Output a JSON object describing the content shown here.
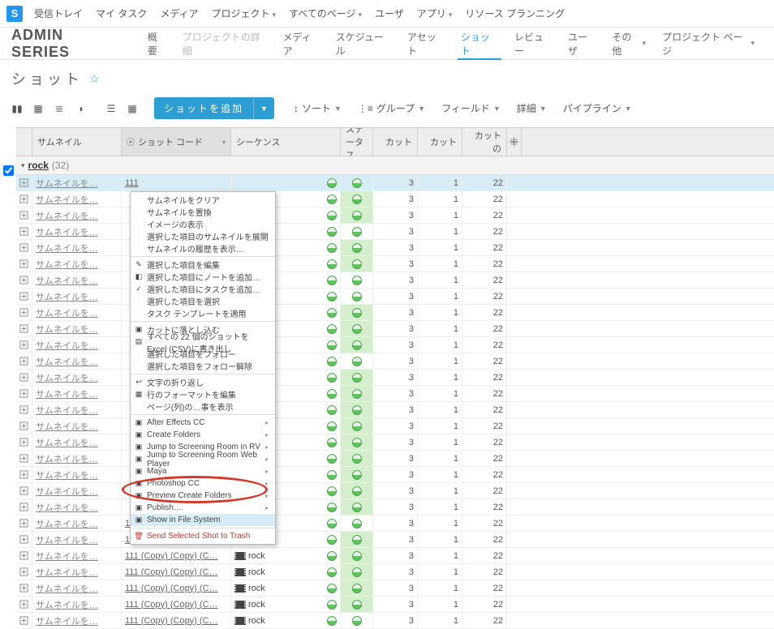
{
  "global_nav": {
    "logo": "S",
    "items": [
      {
        "label": "受信トレイ",
        "dd": false
      },
      {
        "label": "マイ タスク",
        "dd": false
      },
      {
        "label": "メディア",
        "dd": false
      },
      {
        "label": "プロジェクト",
        "dd": true
      },
      {
        "label": "すべてのページ",
        "dd": true
      },
      {
        "label": "ユーザ",
        "dd": false
      },
      {
        "label": "アプリ",
        "dd": true
      },
      {
        "label": "リソース プランニング",
        "dd": false
      }
    ]
  },
  "project_nav": {
    "title": "ADMIN SERIES",
    "items": [
      {
        "label": "概要",
        "dd": false,
        "muted": false
      },
      {
        "label": "プロジェクトの詳細",
        "dd": false,
        "muted": true
      },
      {
        "label": "メディア",
        "dd": false,
        "muted": false
      },
      {
        "label": "スケジュール",
        "dd": false,
        "muted": false
      },
      {
        "label": "アセット",
        "dd": false,
        "muted": false
      },
      {
        "label": "ショット",
        "dd": false,
        "muted": false,
        "active": true
      },
      {
        "label": "レビュー",
        "dd": false,
        "muted": false
      },
      {
        "label": "ユーザ",
        "dd": false,
        "muted": false
      },
      {
        "label": "その他",
        "dd": true,
        "muted": false
      },
      {
        "label": "プロジェクト ページ",
        "dd": true,
        "muted": false
      }
    ]
  },
  "page_title": "ショット",
  "toolbar": {
    "add_label": "ショットを追加",
    "sort": "ソート",
    "group": "グループ",
    "fields": "フィールド",
    "more": "詳細",
    "pipeline": "パイプライン"
  },
  "columns": {
    "thumb": "サムネイル",
    "code": "ショット コード",
    "seq": "シーケンス",
    "status": "ステータス",
    "cin": "カット",
    "cout": "カット",
    "cdur": "カットの"
  },
  "group": {
    "name": "rock",
    "count": "(32)"
  },
  "thumb_placeholder": "サムネイルを…",
  "rows": [
    {
      "code": "111",
      "seq": "",
      "stat_hl": false,
      "cin": 3,
      "cout": 1,
      "cdur": 22,
      "selected": true
    },
    {
      "code": "",
      "seq": "",
      "stat_hl": true,
      "cin": 3,
      "cout": 1,
      "cdur": 22
    },
    {
      "code": "",
      "seq": "",
      "stat_hl": true,
      "cin": 3,
      "cout": 1,
      "cdur": 22
    },
    {
      "code": "",
      "seq": "",
      "stat_hl": false,
      "cin": 3,
      "cout": 1,
      "cdur": 22
    },
    {
      "code": "",
      "seq": "",
      "stat_hl": true,
      "cin": 3,
      "cout": 1,
      "cdur": 22
    },
    {
      "code": "",
      "seq": "",
      "stat_hl": true,
      "cin": 3,
      "cout": 1,
      "cdur": 22
    },
    {
      "code": "",
      "seq": "",
      "stat_hl": false,
      "cin": 3,
      "cout": 1,
      "cdur": 22
    },
    {
      "code": "",
      "seq": "",
      "stat_hl": false,
      "cin": 3,
      "cout": 1,
      "cdur": 22
    },
    {
      "code": "",
      "seq": "",
      "stat_hl": true,
      "cin": 3,
      "cout": 1,
      "cdur": 22
    },
    {
      "code": "",
      "seq": "",
      "stat_hl": true,
      "cin": 3,
      "cout": 1,
      "cdur": 22
    },
    {
      "code": "",
      "seq": "",
      "stat_hl": true,
      "cin": 3,
      "cout": 1,
      "cdur": 22
    },
    {
      "code": "",
      "seq": "",
      "stat_hl": false,
      "cin": 3,
      "cout": 1,
      "cdur": 22
    },
    {
      "code": "",
      "seq": "",
      "stat_hl": true,
      "cin": 3,
      "cout": 1,
      "cdur": 22
    },
    {
      "code": "",
      "seq": "",
      "stat_hl": true,
      "cin": 3,
      "cout": 1,
      "cdur": 22
    },
    {
      "code": "",
      "seq": "",
      "stat_hl": true,
      "cin": 3,
      "cout": 1,
      "cdur": 22
    },
    {
      "code": "",
      "seq": "",
      "stat_hl": true,
      "cin": 3,
      "cout": 1,
      "cdur": 22
    },
    {
      "code": "",
      "seq": "",
      "stat_hl": true,
      "cin": 3,
      "cout": 1,
      "cdur": 22
    },
    {
      "code": "",
      "seq": "",
      "stat_hl": true,
      "cin": 3,
      "cout": 1,
      "cdur": 22
    },
    {
      "code": "",
      "seq": "",
      "stat_hl": true,
      "cin": 3,
      "cout": 1,
      "cdur": 22
    },
    {
      "code": "",
      "seq": "",
      "stat_hl": true,
      "cin": 3,
      "cout": 1,
      "cdur": 22
    },
    {
      "code": "",
      "seq": "",
      "stat_hl": true,
      "cin": 3,
      "cout": 1,
      "cdur": 22
    },
    {
      "code": "111 (Copy) (Copy) (C…",
      "seq": "rock",
      "stat_hl": false,
      "cin": 3,
      "cout": 1,
      "cdur": 22
    },
    {
      "code": "111 (Copy) (Copy) (C…",
      "seq": "rock",
      "stat_hl": true,
      "cin": 3,
      "cout": 1,
      "cdur": 22
    },
    {
      "code": "111 (Copy) (Copy) (C…",
      "seq": "rock",
      "stat_hl": true,
      "cin": 3,
      "cout": 1,
      "cdur": 22
    },
    {
      "code": "111 (Copy) (Copy) (C…",
      "seq": "rock",
      "stat_hl": true,
      "cin": 3,
      "cout": 1,
      "cdur": 22
    },
    {
      "code": "111 (Copy) (Copy) (C…",
      "seq": "rock",
      "stat_hl": true,
      "cin": 3,
      "cout": 1,
      "cdur": 22
    },
    {
      "code": "111 (Copy) (Copy) (C…",
      "seq": "rock",
      "stat_hl": true,
      "cin": 3,
      "cout": 1,
      "cdur": 22
    },
    {
      "code": "111 (Copy) (Copy) (C…",
      "seq": "rock",
      "stat_hl": false,
      "cin": 3,
      "cout": 1,
      "cdur": 22
    }
  ],
  "context_menu": [
    {
      "label": "サムネイルをクリア",
      "icon": ""
    },
    {
      "label": "サムネイルを置換",
      "icon": ""
    },
    {
      "label": "イメージの表示",
      "icon": ""
    },
    {
      "label": "選択した項目のサムネイルを展開",
      "icon": ""
    },
    {
      "label": "サムネイルの履歴を表示…",
      "icon": ""
    },
    {
      "sep": true
    },
    {
      "label": "選択した項目を編集",
      "icon": "✎"
    },
    {
      "label": "選択した項目にノートを追加…",
      "icon": "◧"
    },
    {
      "label": "選択した項目にタスクを追加…",
      "icon": "✓"
    },
    {
      "label": "選択した項目を選択",
      "icon": ""
    },
    {
      "label": "タスク テンプレートを適用",
      "icon": ""
    },
    {
      "sep": true
    },
    {
      "label": "カットに落とし込む",
      "icon": "▣"
    },
    {
      "label": "すべての 22 個のショットを Excel (CSV)に書き出し",
      "icon": "▤"
    },
    {
      "label": "選択した項目をフォロー",
      "icon": ""
    },
    {
      "label": "選択した項目をフォロー解除",
      "icon": ""
    },
    {
      "sep": true
    },
    {
      "label": "文字の折り返し",
      "icon": "↩"
    },
    {
      "label": "行のフォーマットを編集",
      "icon": "▦"
    },
    {
      "label": "ページ(列)の…事を表示",
      "icon": ""
    },
    {
      "sep": true
    },
    {
      "label": "After Effects CC",
      "icon": "▣",
      "sub": true
    },
    {
      "label": "Create Folders",
      "icon": "▣",
      "sub": true
    },
    {
      "label": "Jump to Screening Room in RV",
      "icon": "▣",
      "sub": true
    },
    {
      "label": "Jump to Screening Room Web Player",
      "icon": "▣",
      "sub": true
    },
    {
      "label": "Maya",
      "icon": "▣",
      "sub": true
    },
    {
      "label": "Photoshop CC",
      "icon": "▣",
      "sub": true
    },
    {
      "label": "Preview Create Folders",
      "icon": "▣",
      "sub": true
    },
    {
      "label": "Publish…",
      "icon": "▣",
      "sub": true
    },
    {
      "label": "Show in File System",
      "icon": "▣",
      "hl": true
    },
    {
      "sep": true
    },
    {
      "label": "Send Selected Shot to Trash",
      "icon": "🗑",
      "red": true
    }
  ]
}
